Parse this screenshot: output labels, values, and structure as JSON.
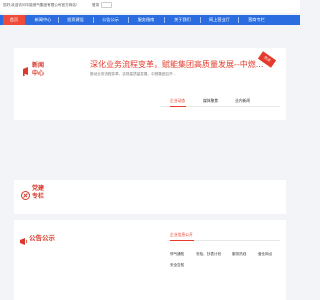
{
  "header": {
    "welcome_text": "您好,欢迎访问中能燃气集团有限公司官方网站!",
    "login_link": "登录"
  },
  "nav": {
    "items": [
      {
        "label": "首页",
        "active": true
      },
      {
        "label": "新闻中心"
      },
      {
        "label": "投资建设"
      },
      {
        "label": "公告公示"
      },
      {
        "label": "服务指南"
      },
      {
        "label": "关于我们"
      },
      {
        "label": "网上营业厅"
      },
      {
        "label": "营商专栏"
      }
    ]
  },
  "news": {
    "section_title_line1": "新闻",
    "section_title_line2": "中心",
    "headline": "深化业务流程变革，赋能集团高质量发展--中燃...",
    "summary": "推动业务流程变革，实现高质量发展，中燃集团召开...",
    "ribbon": "热点",
    "tabs": [
      {
        "label": "企业动态",
        "active": true
      },
      {
        "label": "媒体聚焦"
      },
      {
        "label": "业内新闻"
      }
    ]
  },
  "party": {
    "section_title_line1": "党建",
    "section_title_line2": "专栏"
  },
  "notice": {
    "section_title": "公告公示",
    "tabs": [
      {
        "label": "企业信息公开",
        "active": true
      },
      {
        "label": "停气通知"
      },
      {
        "label": "安检、抄表计划"
      },
      {
        "label": "服务热线"
      },
      {
        "label": "营业网点"
      },
      {
        "label": "安全告知"
      }
    ]
  },
  "colors": {
    "nav_blue": "#2b6de0",
    "accent_red": "#e43b2c",
    "page_bg": "#f2f4f7"
  }
}
